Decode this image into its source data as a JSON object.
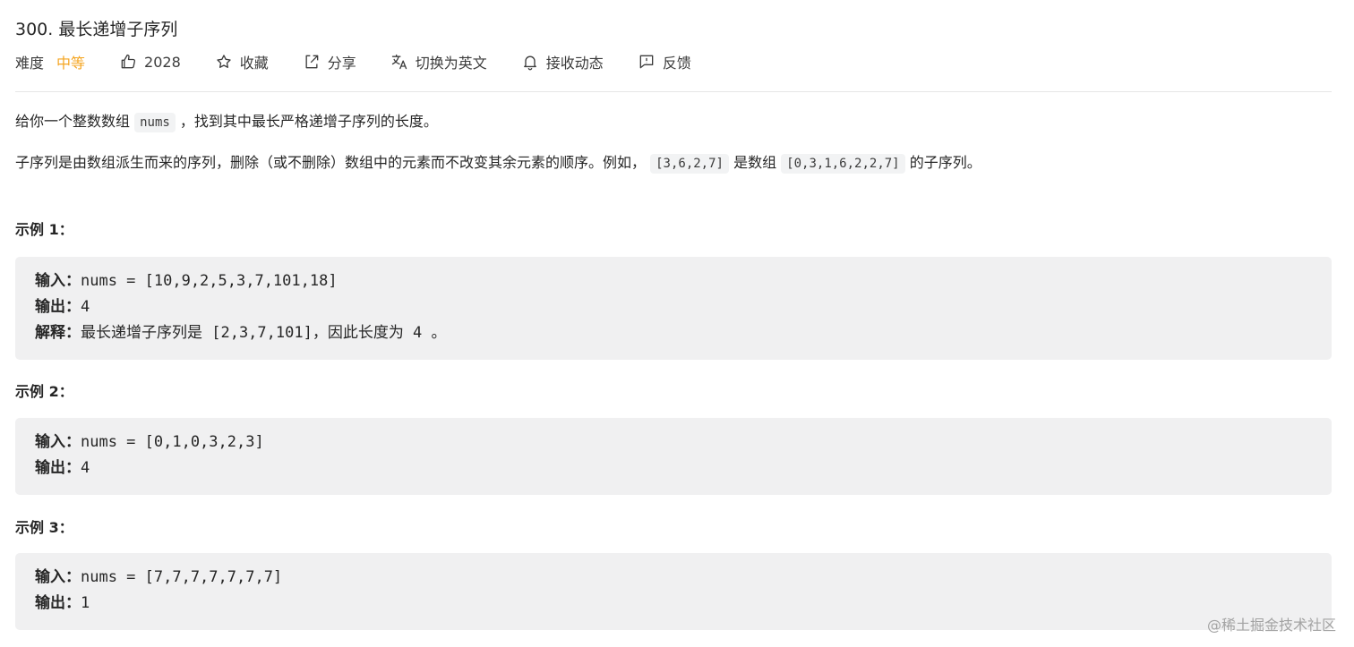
{
  "header": {
    "title": "300. 最长递增子序列",
    "difficulty_label": "难度",
    "difficulty_value": "中等",
    "likes": "2028",
    "favorite_label": "收藏",
    "share_label": "分享",
    "translate_label": "切换为英文",
    "subscribe_label": "接收动态",
    "feedback_label": "反馈"
  },
  "colors": {
    "difficulty_medium": "#f5a623",
    "code_bg": "#f0f0f1",
    "divider": "#e6e6e6"
  },
  "description": {
    "p1_before": "给你一个整数数组",
    "p1_code": "nums",
    "p1_after": "，找到其中最长严格递增子序列的长度。",
    "p2_before": "子序列是由数组派生而来的序列，删除（或不删除）数组中的元素而不改变其余元素的顺序。例如，",
    "p2_code1": "[3,6,2,7]",
    "p2_mid": "是数组",
    "p2_code2": "[0,3,1,6,2,2,7]",
    "p2_after": "的子序列。"
  },
  "examples": [
    {
      "title": "示例 1：",
      "input_label": "输入：",
      "input": "nums = [10,9,2,5,3,7,101,18]",
      "output_label": "输出：",
      "output": "4",
      "explain_label": "解释：",
      "explain": "最长递增子序列是 [2,3,7,101]，因此长度为 4 。"
    },
    {
      "title": "示例 2：",
      "input_label": "输入：",
      "input": "nums = [0,1,0,3,2,3]",
      "output_label": "输出：",
      "output": "4"
    },
    {
      "title": "示例 3：",
      "input_label": "输入：",
      "input": "nums = [7,7,7,7,7,7,7]",
      "output_label": "输出：",
      "output": "1"
    }
  ],
  "watermark": "@稀土掘金技术社区",
  "icons": [
    "thumbs-up-icon",
    "star-icon",
    "share-icon",
    "translate-icon",
    "bell-icon",
    "feedback-icon"
  ]
}
